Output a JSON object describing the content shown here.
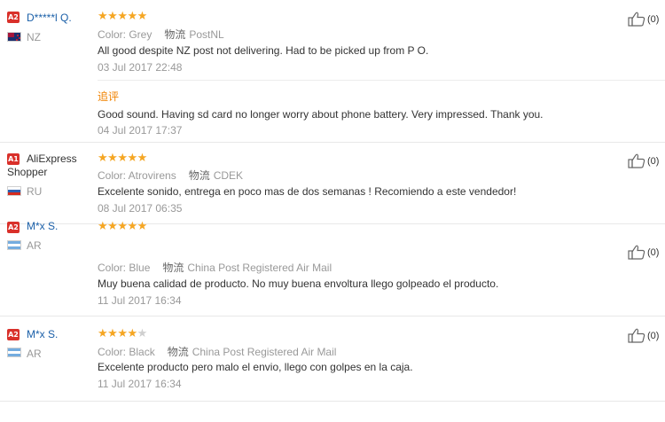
{
  "reviews": [
    {
      "badge": "A2",
      "user": "D*****l Q.",
      "country": "NZ",
      "rating": 5,
      "color_label": "Color: Grey",
      "shipping_label": "物流",
      "shipping": "PostNL",
      "text": "All good despite NZ post not delivering. Had to be picked up from P O.",
      "date": "03 Jul 2017 22:48",
      "append_title": "追评",
      "append_text": "Good sound. Having sd card no longer worry about phone battery. Very impressed. Thank you.",
      "append_date": "04 Jul 2017 17:37",
      "helpful": "(0)"
    },
    {
      "badge": "A1",
      "user": "AliExpress Shopper",
      "country": "RU",
      "rating": 5,
      "color_label": "Color: Atrovirens",
      "shipping_label": "物流",
      "shipping": "CDEK",
      "text": "Excelente sonido, entrega en poco mas de dos semanas ! Recomiendo a este vendedor!",
      "date": "08 Jul 2017 06:35",
      "helpful": "(0)"
    },
    {
      "badge": "A2",
      "user": "M*x S.",
      "country": "AR",
      "rating": 5,
      "color_label": "Color: Blue",
      "shipping_label": "物流",
      "shipping": "China Post Registered Air Mail",
      "text": "Muy buena calidad de producto. No muy buena envoltura llego golpeado el producto.",
      "date": "11 Jul 2017 16:34",
      "helpful": "(0)"
    },
    {
      "badge": "A2",
      "user": "M*x S.",
      "country": "AR",
      "rating": 4,
      "color_label": "Color: Black",
      "shipping_label": "物流",
      "shipping": "China Post Registered Air Mail",
      "text": "Excelente producto pero malo el envio, llego con golpes en la caja.",
      "date": "11 Jul 2017 16:34",
      "helpful": "(0)"
    }
  ],
  "colors": {
    "badge": "#d9302a",
    "user_link": "#1a5fa8",
    "star": "#f5a623",
    "append_title": "#f08200"
  },
  "icons": {
    "helpful": "thumbs-up-icon",
    "rating": "star-icon"
  }
}
